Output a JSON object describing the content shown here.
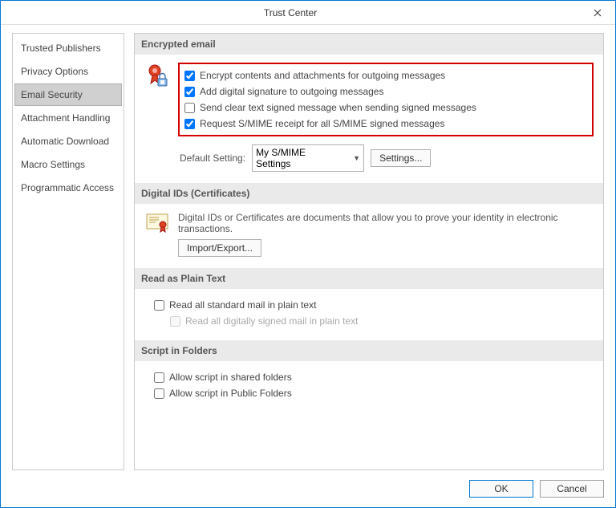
{
  "window": {
    "title": "Trust Center"
  },
  "sidebar": {
    "items": [
      {
        "label": "Trusted Publishers"
      },
      {
        "label": "Privacy Options"
      },
      {
        "label": "Email Security"
      },
      {
        "label": "Attachment Handling"
      },
      {
        "label": "Automatic Download"
      },
      {
        "label": "Macro Settings"
      },
      {
        "label": "Programmatic Access"
      }
    ],
    "active_index": 2
  },
  "sections": {
    "encrypted": {
      "heading": "Encrypted email",
      "options": [
        {
          "label": "Encrypt contents and attachments for outgoing messages",
          "checked": true
        },
        {
          "label": "Add digital signature to outgoing messages",
          "checked": true
        },
        {
          "label": "Send clear text signed message when sending signed messages",
          "checked": false
        },
        {
          "label": "Request S/MIME receipt for all S/MIME signed messages",
          "checked": true
        }
      ],
      "default_label": "Default Setting:",
      "default_value": "My S/MIME Settings",
      "settings_button": "Settings..."
    },
    "digital_ids": {
      "heading": "Digital IDs (Certificates)",
      "description": "Digital IDs or Certificates are documents that allow you to prove your identity in electronic transactions.",
      "import_button": "Import/Export..."
    },
    "plain_text": {
      "heading": "Read as Plain Text",
      "options": [
        {
          "label": "Read all standard mail in plain text",
          "checked": false
        },
        {
          "label": "Read all digitally signed mail in plain text",
          "checked": false,
          "disabled": true,
          "sub": true
        }
      ]
    },
    "script": {
      "heading": "Script in Folders",
      "options": [
        {
          "label": "Allow script in shared folders",
          "checked": false
        },
        {
          "label": "Allow script in Public Folders",
          "checked": false
        }
      ]
    }
  },
  "footer": {
    "ok": "OK",
    "cancel": "Cancel"
  }
}
